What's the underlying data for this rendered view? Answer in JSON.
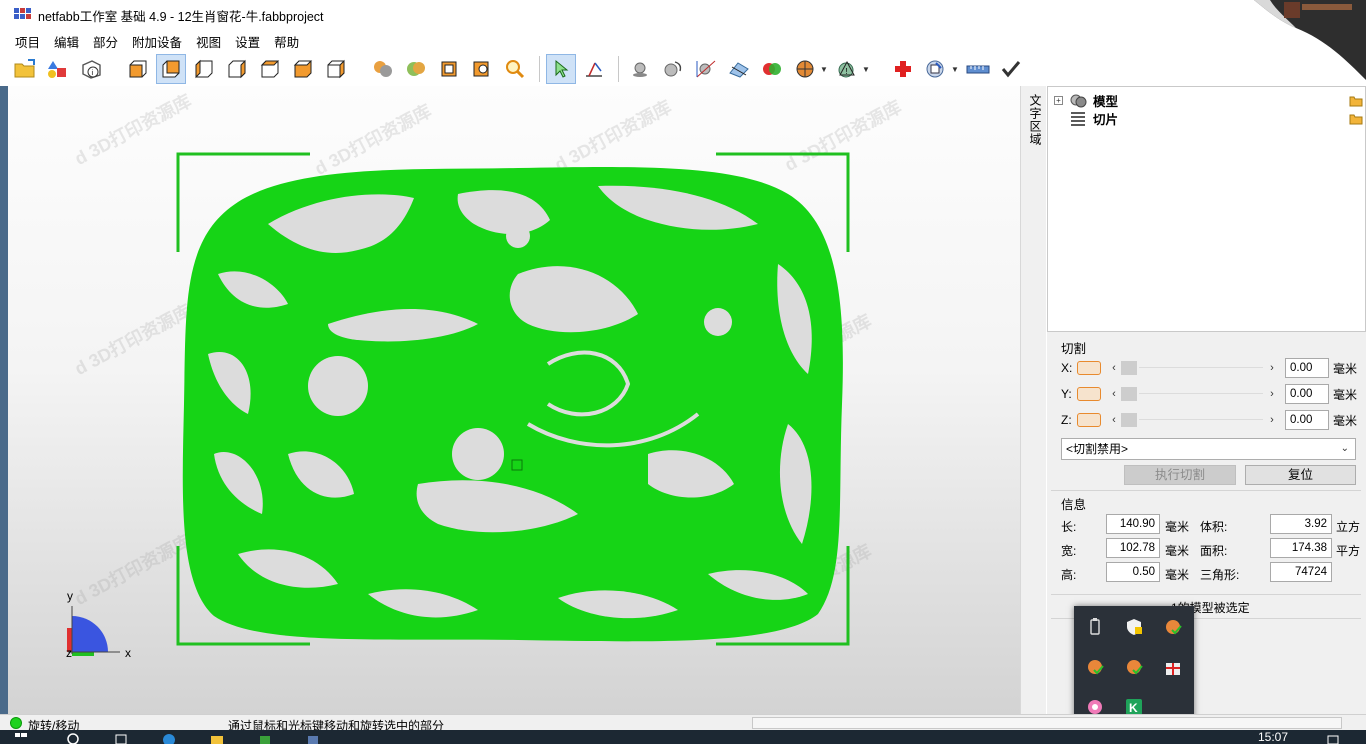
{
  "window": {
    "title": "netfabb工作室 基础 4.9 - 12生肖窗花-牛.fabbproject"
  },
  "menu": [
    "项目",
    "编辑",
    "部分",
    "附加设备",
    "视图",
    "设置",
    "帮助"
  ],
  "toolbar": {
    "groups": [
      [
        "open-project-icon",
        "add-part-icon",
        "part-info-icon"
      ],
      [
        "view-front-icon",
        "view-back-icon",
        "view-left-icon",
        "view-right-icon",
        "view-top-icon",
        "view-bottom-icon",
        "view-iso-icon"
      ],
      [
        "shading-icon",
        "texture-icon",
        "zoom-fit-icon",
        "zoom-selection-icon",
        "magnifier-icon"
      ],
      [
        "select-pointer-icon",
        "measure-icon"
      ],
      [
        "move-part-icon",
        "rotate-part-icon",
        "scale-part-icon",
        "mirror-part-icon",
        "boolean-icon",
        "section-icon",
        "analysis-icon"
      ],
      [
        "repair-icon",
        "export-icon",
        "ruler-icon",
        "check-icon"
      ]
    ],
    "active_tool": "view-back-icon"
  },
  "side_tab": "文字区域",
  "tree": {
    "items": [
      {
        "label": "模型",
        "icon": "model-icon"
      },
      {
        "label": "切片",
        "icon": "slice-icon"
      }
    ]
  },
  "cut": {
    "title": "切割",
    "axes": [
      {
        "label": "X:",
        "value": "0.00",
        "unit": "毫米"
      },
      {
        "label": "Y:",
        "value": "0.00",
        "unit": "毫米"
      },
      {
        "label": "Z:",
        "value": "0.00",
        "unit": "毫米"
      }
    ],
    "mode_select": "<切割禁用>",
    "execute_label": "执行切割",
    "reset_label": "复位"
  },
  "info": {
    "title": "信息",
    "length_label": "长:",
    "length_value": "140.90",
    "length_unit": "毫米",
    "width_label": "宽:",
    "width_value": "102.78",
    "width_unit": "毫米",
    "height_label": "高:",
    "height_value": "0.50",
    "height_unit": "毫米",
    "volume_label": "体积:",
    "volume_value": "3.92",
    "volume_unit": "立方",
    "area_label": "面积:",
    "area_value": "174.38",
    "area_unit": "平方",
    "triangles_label": "三角形:",
    "triangles_value": "74724",
    "selection_status": "1的模型被选定"
  },
  "axes_gizmo": {
    "x": "x",
    "y": "y",
    "z": "z"
  },
  "status": {
    "mode": "旋转/移动",
    "hint": "通过鼠标和光标键移动和旋转选中的部分"
  },
  "taskbar": {
    "time": "15:07"
  },
  "colors": {
    "model_green": "#16d416",
    "selection_bracket": "#20c020",
    "chip_orange": "#e88a2e"
  }
}
